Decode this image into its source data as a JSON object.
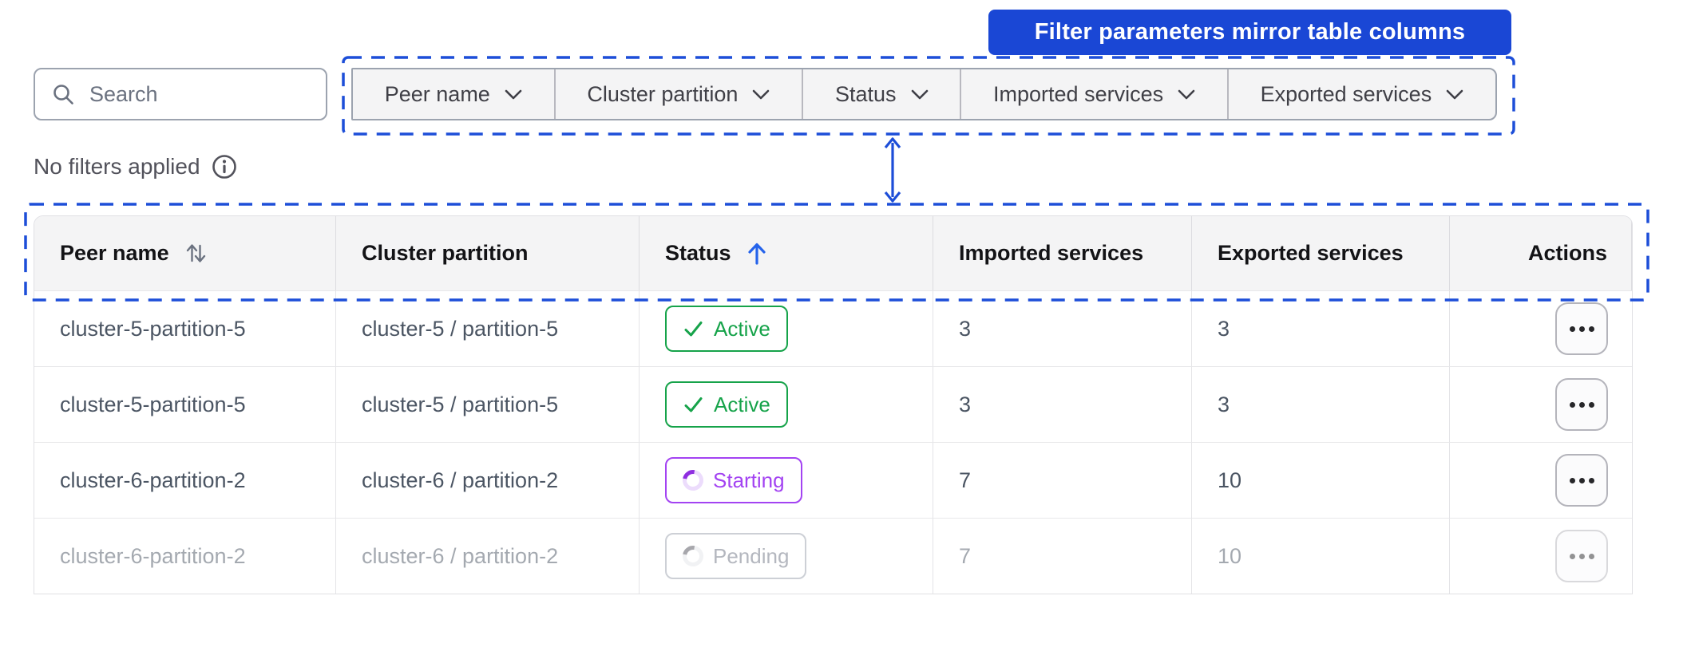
{
  "banner": {
    "label": "Filter parameters mirror table columns"
  },
  "search": {
    "placeholder": "Search"
  },
  "filters": {
    "items": [
      {
        "label": "Peer name"
      },
      {
        "label": "Cluster partition"
      },
      {
        "label": "Status"
      },
      {
        "label": "Imported services"
      },
      {
        "label": "Exported services"
      }
    ]
  },
  "filter_status": {
    "text": "No filters applied"
  },
  "table": {
    "columns": [
      {
        "label": "Peer name",
        "sort": "both",
        "align": "left"
      },
      {
        "label": "Cluster partition",
        "sort": "none",
        "align": "left"
      },
      {
        "label": "Status",
        "sort": "asc",
        "align": "left"
      },
      {
        "label": "Imported services",
        "sort": "none",
        "align": "left"
      },
      {
        "label": "Exported services",
        "sort": "none",
        "align": "left"
      },
      {
        "label": "Actions",
        "sort": "none",
        "align": "right"
      }
    ],
    "rows": [
      {
        "peer_name": "cluster-5-partition-5",
        "cluster_partition": "cluster-5 / partition-5",
        "status": "Active",
        "status_type": "active",
        "imported_services": "3",
        "exported_services": "3",
        "faded": false
      },
      {
        "peer_name": "cluster-5-partition-5",
        "cluster_partition": "cluster-5 / partition-5",
        "status": "Active",
        "status_type": "active",
        "imported_services": "3",
        "exported_services": "3",
        "faded": false
      },
      {
        "peer_name": "cluster-6-partition-2",
        "cluster_partition": "cluster-6 / partition-2",
        "status": "Starting",
        "status_type": "starting",
        "imported_services": "7",
        "exported_services": "10",
        "faded": false
      },
      {
        "peer_name": "cluster-6-partition-2",
        "cluster_partition": "cluster-6 / partition-2",
        "status": "Pending",
        "status_type": "pending",
        "imported_services": "7",
        "exported_services": "10",
        "faded": true
      }
    ]
  },
  "colors": {
    "accent_blue": "#1d4ed8",
    "banner_blue": "#1a47d5",
    "active_green": "#16a34a",
    "starting_purple": "#a343f2",
    "pending_gray": "#6b7280"
  }
}
